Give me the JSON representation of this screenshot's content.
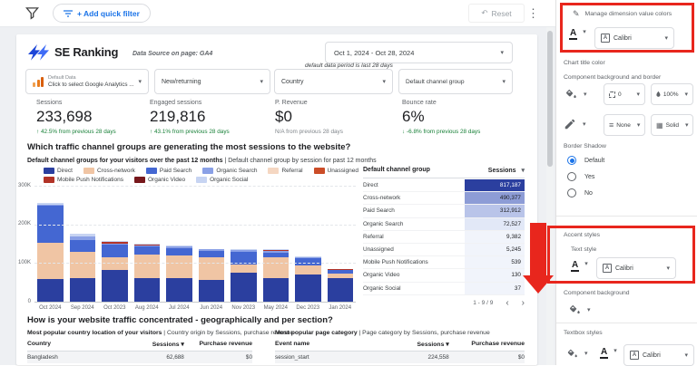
{
  "icons": {
    "dropdown": "▾",
    "kebab": "⋮",
    "undo": "↶",
    "pencil": "✎",
    "sort": "▾",
    "chevron_left": "‹",
    "chevron_right": "›",
    "up_arrow": "↑",
    "down_arrow": "↓",
    "border_weight": "≡",
    "border_style": "▦"
  },
  "topbar": {
    "add_quick_filter": "+ Add quick filter",
    "reset": "Reset"
  },
  "header": {
    "brand": "SE Ranking",
    "data_source": "Data Source on page: GA4",
    "date_range": "Oct 1, 2024 - Oct 28, 2024"
  },
  "filters": {
    "default_data_label": "Default Data",
    "default_data_value": "Click to select Google Analytics ...",
    "new_returning": "New/returning",
    "country": "Country",
    "period_note": "default data period is last 28 days",
    "channel_group": "Default channel group"
  },
  "metrics": [
    {
      "label": "Sessions",
      "value": "233,698",
      "delta": "42.5% from previous 28 days",
      "dir": "up",
      "tone": "pos"
    },
    {
      "label": "Engaged sessions",
      "value": "219,816",
      "delta": "43.1% from previous 28 days",
      "dir": "up",
      "tone": "pos"
    },
    {
      "label": "P. Revenue",
      "value": "$0",
      "delta": "N/A from previous 28 days",
      "dir": "none",
      "tone": "neutral"
    },
    {
      "label": "Bounce rate",
      "value": "6%",
      "delta": "-6.8% from previous 28 days",
      "dir": "down",
      "tone": "pos"
    }
  ],
  "chart_section": {
    "question": "Which traffic channel groups are generating the most sessions to the website?",
    "subtitle_bold": "Default channel groups for your visitors over the past 12 months",
    "subtitle_rest": " | Default channel group by session for past 12 months"
  },
  "chart_data": {
    "type": "bar",
    "stacked": true,
    "title": "Default channel groups for your visitors over the past 12 months",
    "xlabel": "",
    "ylabel": "Sessions",
    "ylim": [
      0,
      300000
    ],
    "yticks": [
      0,
      100000,
      200000,
      300000
    ],
    "ytick_labels": [
      "0",
      "100K",
      "200K",
      "300K"
    ],
    "grid": true,
    "legend_position": "top",
    "categories": [
      "Oct 2024",
      "Sep 2024",
      "Oct 2023",
      "Aug 2024",
      "Jul 2024",
      "Jun 2024",
      "Nov 2023",
      "May 2024",
      "Dec 2023",
      "Jan 2024"
    ],
    "series": [
      {
        "name": "Direct",
        "color": "#2b3f9f",
        "values": [
          58000,
          60000,
          82000,
          62000,
          62000,
          56000,
          76000,
          60000,
          70000,
          60000
        ]
      },
      {
        "name": "Cross-network",
        "color": "#f0c5a4",
        "values": [
          94000,
          68000,
          33000,
          60000,
          58000,
          59000,
          21000,
          55000,
          23000,
          12000
        ]
      },
      {
        "name": "Paid Search",
        "color": "#4467d2",
        "values": [
          96000,
          32000,
          32000,
          20000,
          18000,
          17000,
          33000,
          12000,
          19000,
          10000
        ]
      },
      {
        "name": "Organic Search",
        "color": "#8aa0e6",
        "values": [
          4000,
          8000,
          4000,
          4000,
          4000,
          3000,
          3000,
          5000,
          3000,
          1000
        ]
      },
      {
        "name": "Referral",
        "color": "#f5d7c2",
        "values": [
          0,
          0,
          0,
          0,
          0,
          0,
          0,
          0,
          0,
          0
        ]
      },
      {
        "name": "Unassigned",
        "color": "#cb4d28",
        "values": [
          0,
          0,
          0,
          0,
          0,
          0,
          0,
          0,
          0,
          0
        ]
      },
      {
        "name": "Mobile Push Notifications",
        "color": "#b23327",
        "values": [
          0,
          2000,
          4000,
          1000,
          1000,
          1000,
          1000,
          1000,
          500,
          500
        ]
      },
      {
        "name": "Organic Video",
        "color": "#77181c",
        "values": [
          0,
          0,
          0,
          0,
          0,
          0,
          0,
          0,
          0,
          0
        ]
      },
      {
        "name": "Organic Social",
        "color": "#c7d4f2",
        "values": [
          3000,
          5000,
          3000,
          3000,
          3000,
          1000,
          1000,
          3000,
          1500,
          500
        ]
      }
    ]
  },
  "channel_table": {
    "col1": "Default channel group",
    "col2": "Sessions",
    "rows": [
      {
        "label": "Direct",
        "value": "817,187",
        "bg": "#2b3f9f",
        "fg": "#ffffff"
      },
      {
        "label": "Cross-network",
        "value": "490,377",
        "bg": "#8d9cd6",
        "fg": "#202124"
      },
      {
        "label": "Paid Search",
        "value": "312,912",
        "bg": "#b9c4e9",
        "fg": "#202124"
      },
      {
        "label": "Organic Search",
        "value": "72,527",
        "bg": "#e2e8f7",
        "fg": "#202124"
      },
      {
        "label": "Referral",
        "value": "9,382",
        "bg": "#f1f4fb",
        "fg": "#202124"
      },
      {
        "label": "Unassigned",
        "value": "5,245",
        "bg": "#f1f4fb",
        "fg": "#202124"
      },
      {
        "label": "Mobile Push Notifications",
        "value": "539",
        "bg": "#f1f4fb",
        "fg": "#202124"
      },
      {
        "label": "Organic Video",
        "value": "130",
        "bg": "#f1f4fb",
        "fg": "#202124"
      },
      {
        "label": "Organic Social",
        "value": "37",
        "bg": "#f1f4fb",
        "fg": "#202124"
      }
    ],
    "pagination": "1 - 9 / 9"
  },
  "bottom_section": {
    "question": "How is your website traffic concentrated - geographically and per section?",
    "left": {
      "subtitle_bold": "Most popular country location of your visitors",
      "subtitle_rest": " | Country origin by Sessions, purchase revenue",
      "headers": [
        "Country",
        "Sessions",
        "Purchase revenue"
      ],
      "rows": [
        [
          "Bangladesh",
          "62,688",
          "$0"
        ]
      ]
    },
    "right": {
      "subtitle_bold": "Most popular page category",
      "subtitle_rest": " | Page category by Sessions, purchase revenue",
      "headers": [
        "Event name",
        "Sessions",
        "Purchase revenue"
      ],
      "rows": [
        [
          "session_start",
          "224,558",
          "$0"
        ]
      ]
    }
  },
  "panel": {
    "manage_colors": "Manage dimension value colors",
    "font_family": "Calibri",
    "chart_title_color": "Chart title color",
    "component_bg_border": "Component background and border",
    "corner_value": "0",
    "opacity_value": "100%",
    "border_weight": "None",
    "border_style": "Solid",
    "border_shadow": "Border Shadow",
    "radio_options": [
      "Default",
      "Yes",
      "No"
    ],
    "radio_selected": "Default",
    "accent_styles": "Accent styles",
    "text_style": "Text style",
    "component_background": "Component background",
    "textbox_styles": "Textbox styles"
  },
  "colors": {
    "accent_blue": "#1a73e8",
    "positive": "#188038",
    "annotation": "#e8261d"
  }
}
